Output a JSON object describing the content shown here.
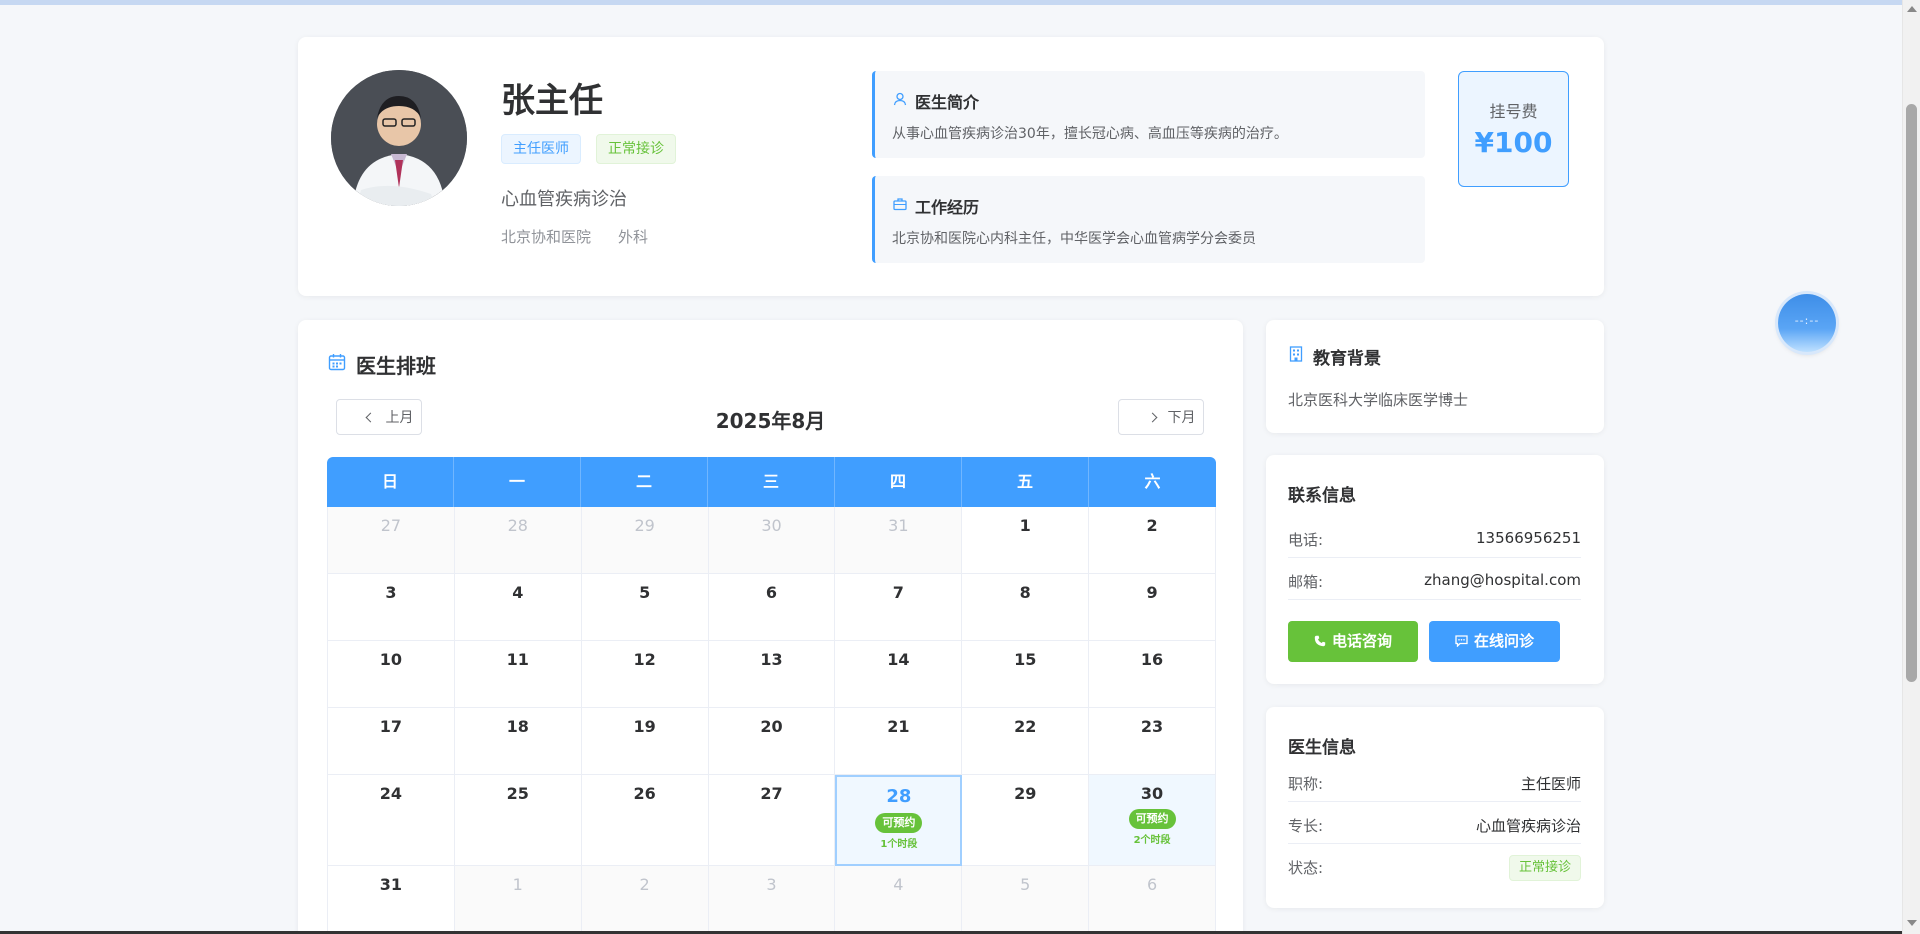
{
  "doctor": {
    "name": "张主任",
    "title_tag": "主任医师",
    "status_tag": "正常接诊",
    "specialty": "心血管疾病诊治",
    "hospital": "北京协和医院",
    "department": "外科"
  },
  "intro": {
    "title": "医生简介",
    "text": "从事心血管疾病诊治30年，擅长冠心病、高血压等疾病的治疗。"
  },
  "experience": {
    "title": "工作经历",
    "text": "北京协和医院心内科主任，中华医学会心血管病学分会委员"
  },
  "fee": {
    "label": "挂号费",
    "value": "¥100"
  },
  "schedule": {
    "title": "医生排班",
    "prev_label": "上月",
    "next_label": "下月",
    "month": "2025年8月",
    "weekdays": [
      "日",
      "一",
      "二",
      "三",
      "四",
      "五",
      "六"
    ],
    "weeks": [
      [
        {
          "d": "27",
          "other": true
        },
        {
          "d": "28",
          "other": true
        },
        {
          "d": "29",
          "other": true
        },
        {
          "d": "30",
          "other": true
        },
        {
          "d": "31",
          "other": true
        },
        {
          "d": "1"
        },
        {
          "d": "2"
        }
      ],
      [
        {
          "d": "3"
        },
        {
          "d": "4"
        },
        {
          "d": "5"
        },
        {
          "d": "6"
        },
        {
          "d": "7"
        },
        {
          "d": "8"
        },
        {
          "d": "9"
        }
      ],
      [
        {
          "d": "10"
        },
        {
          "d": "11"
        },
        {
          "d": "12"
        },
        {
          "d": "13"
        },
        {
          "d": "14"
        },
        {
          "d": "15"
        },
        {
          "d": "16"
        }
      ],
      [
        {
          "d": "17"
        },
        {
          "d": "18"
        },
        {
          "d": "19"
        },
        {
          "d": "20"
        },
        {
          "d": "21"
        },
        {
          "d": "22"
        },
        {
          "d": "23"
        }
      ],
      [
        {
          "d": "24"
        },
        {
          "d": "25"
        },
        {
          "d": "26"
        },
        {
          "d": "27"
        },
        {
          "d": "28",
          "available": true,
          "selected": true,
          "badge": "可预约",
          "slots": "1个时段"
        },
        {
          "d": "29"
        },
        {
          "d": "30",
          "available": true,
          "badge": "可预约",
          "slots": "2个时段"
        }
      ],
      [
        {
          "d": "31"
        },
        {
          "d": "1",
          "other": true
        },
        {
          "d": "2",
          "other": true
        },
        {
          "d": "3",
          "other": true
        },
        {
          "d": "4",
          "other": true
        },
        {
          "d": "5",
          "other": true
        },
        {
          "d": "6",
          "other": true
        }
      ]
    ]
  },
  "education": {
    "title": "教育背景",
    "text": "北京医科大学临床医学博士"
  },
  "contact": {
    "title": "联系信息",
    "phone_label": "电话:",
    "phone_value": "13566956251",
    "email_label": "邮箱:",
    "email_value": "zhang@hospital.com",
    "call_button": "电话咨询",
    "chat_button": "在线问诊"
  },
  "doctor_info": {
    "title": "医生信息",
    "rank_label": "职称:",
    "rank_value": "主任医师",
    "specialty_label": "专长:",
    "specialty_value": "心血管疾病诊治",
    "status_label": "状态:",
    "status_value": "正常接诊"
  },
  "float_button": {
    "text": "--:--"
  },
  "colors": {
    "primary": "#409eff",
    "success": "#67c23a",
    "background": "#f5f7fa"
  }
}
